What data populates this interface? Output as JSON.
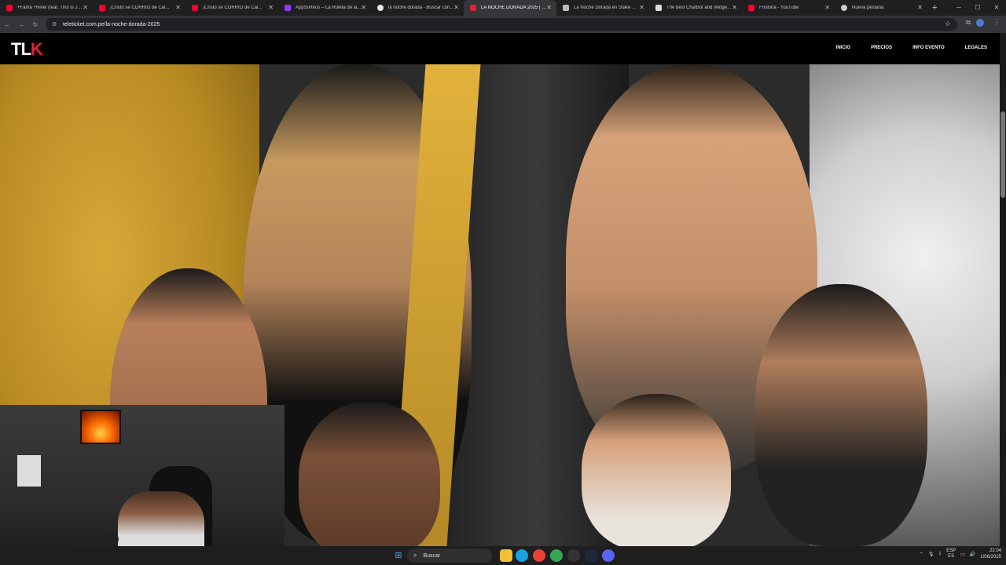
{
  "browser": {
    "tabs": [
      {
        "title": "+Fama +Nivel (feat. This Is Je...",
        "icon": "youtube-icon",
        "color": "#ff0033"
      },
      {
        "title": "¡Cristo se CORRIÓ de Cal...",
        "icon": "youtube-icon",
        "color": "#ff0033"
      },
      {
        "title": "¡Cristo se CORRIÓ de Cal...",
        "icon": "youtube-icon",
        "color": "#ff0033"
      },
      {
        "title": "AppSorteos – La Ruleta de la...",
        "icon": "appsorteos-icon",
        "color": "#8a3ffc"
      },
      {
        "title": "la noche dorada - Buscar con...",
        "icon": "google-icon",
        "color": "#e8e8e8"
      },
      {
        "title": "LA NOCHE DORADA 2025 | TL...",
        "icon": "teleticket-icon",
        "color": "#e0213a",
        "active": true
      },
      {
        "title": "La Noche Dorada en Stake Pe...",
        "icon": "stake-icon",
        "color": "#bbbbbb"
      },
      {
        "title": "The best ChatBot and Widge...",
        "icon": "chatbot-icon",
        "color": "#dddddd"
      },
      {
        "title": "Friolona - YouTube",
        "icon": "youtube-icon",
        "color": "#ff0033"
      },
      {
        "title": "Nueva pestaña",
        "icon": "newtab-icon",
        "color": "#cccccc"
      }
    ],
    "url": "teleticket.com.pe/la-noche-dorada-2025"
  },
  "site": {
    "logo_prefix": "TL",
    "logo_k": "K",
    "nav": [
      "INICIO",
      "PRECIOS",
      "INFO EVENTO",
      "LEGALES"
    ]
  },
  "taskbar": {
    "search_label": "Buscar",
    "lang_top": "ESP",
    "lang_bottom": "ES",
    "time": "22:04",
    "date": "1/08/2025"
  },
  "colors": {
    "brand_red": "#e0213a",
    "hero_gold": "#d7a939",
    "header_bg": "#000000"
  }
}
